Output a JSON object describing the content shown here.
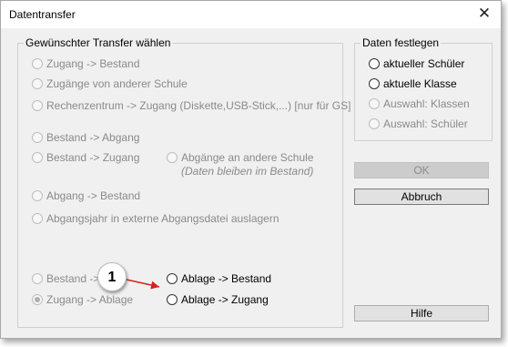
{
  "window": {
    "title": "Datentransfer",
    "close_icon": "close-icon"
  },
  "transfer_group": {
    "legend": "Gewünschter Transfer wählen",
    "options": {
      "zugang_bestand": "Zugang -> Bestand",
      "zugaenge_andere_schule": "Zugänge von anderer Schule",
      "rechenzentrum_zugang": "Rechenzentrum -> Zugang (Diskette,USB-Stick,...) [nur für GS]",
      "bestand_abgang": "Bestand -> Abgang",
      "bestand_zugang": "Bestand -> Zugang",
      "abgaenge_andere_schule": "Abgänge an andere Schule",
      "abgaenge_note": "(Daten bleiben im Bestand)",
      "abgang_bestand": "Abgang -> Bestand",
      "abgangsjahr_extern": "Abgangsjahr in externe Abgangsdatei auslagern",
      "bestand_ablage": "Bestand ->",
      "zugang_ablage": "Zugang -> Ablage",
      "ablage_bestand": "Ablage -> Bestand",
      "ablage_zugang": "Ablage -> Zugang"
    },
    "selected": "zugang_ablage"
  },
  "data_group": {
    "legend": "Daten festlegen",
    "options": {
      "aktueller_schueler": "aktueller Schüler",
      "aktuelle_klasse": "aktuelle Klasse",
      "auswahl_klassen": "Auswahl: Klassen",
      "auswahl_schueler": "Auswahl: Schüler"
    }
  },
  "buttons": {
    "ok": "OK",
    "abbruch": "Abbruch",
    "hilfe": "Hilfe"
  },
  "callout": {
    "number": "1",
    "arrow_color": "#d62020"
  }
}
